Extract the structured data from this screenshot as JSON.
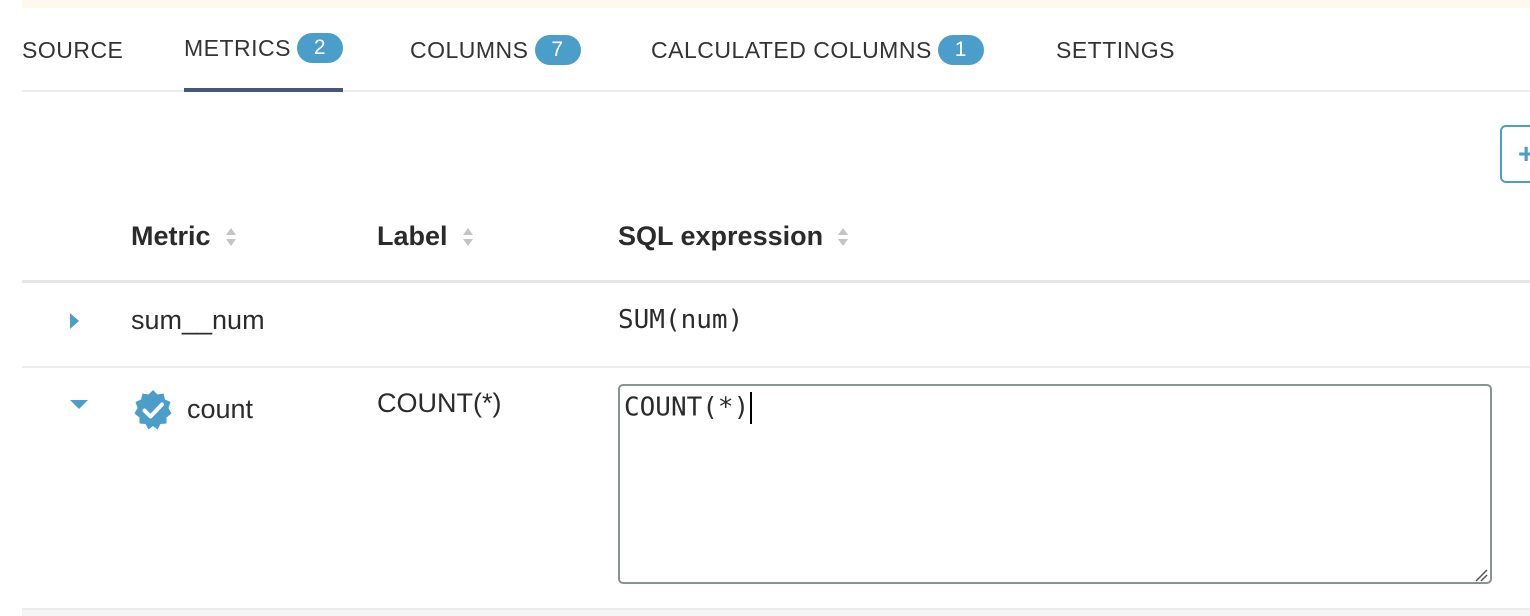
{
  "tabs": [
    {
      "label": "SOURCE",
      "badge": null,
      "active": false
    },
    {
      "label": "METRICS",
      "badge": "2",
      "active": true
    },
    {
      "label": "COLUMNS",
      "badge": "7",
      "active": false
    },
    {
      "label": "CALCULATED COLUMNS",
      "badge": "1",
      "active": false
    },
    {
      "label": "SETTINGS",
      "badge": null,
      "active": false
    }
  ],
  "add_button": {
    "icon": "plus-icon",
    "label": "+"
  },
  "table": {
    "headers": [
      "Metric",
      "Label",
      "SQL expression"
    ],
    "rows": [
      {
        "metric": "sum__num",
        "label": "",
        "sql": "SUM(num)",
        "expanded": false,
        "certified": false
      },
      {
        "metric": "count",
        "label": "COUNT(*)",
        "sql": "COUNT(*)",
        "expanded": true,
        "certified": true
      }
    ]
  },
  "colors": {
    "accent": "#4b9ec9",
    "active_tab_underline": "#47557e",
    "banner": "#fdf9ec"
  }
}
